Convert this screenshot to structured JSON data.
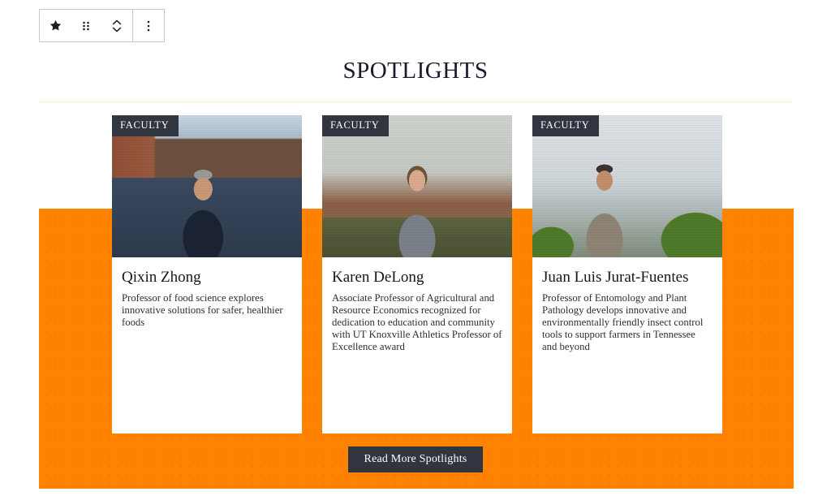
{
  "editor_toolbar": {
    "buttons": [
      {
        "name": "block-type-star-button",
        "icon": "star-icon"
      },
      {
        "name": "drag-handle-button",
        "icon": "drag-dots-icon"
      },
      {
        "name": "move-up-down-button",
        "icon": "chevron-up-down-icon"
      },
      {
        "name": "more-options-button",
        "icon": "vertical-dots-icon"
      }
    ]
  },
  "section": {
    "heading": "SPOTLIGHTS",
    "cta_label": "Read More Spotlights"
  },
  "cards": [
    {
      "badge": "FACULTY",
      "title": "Qixin Zhong",
      "description": "Professor of food science explores innovative solutions for safer, healthier foods",
      "photo_alt": "Qixin Zhong standing in front of the Food Science building"
    },
    {
      "badge": "FACULTY",
      "title": "Karen DeLong",
      "description": "Associate Professor of Agricultural and Resource Economics recognized for dedication to education and community with UT Knoxville Athletics Professor of Excellence award",
      "photo_alt": "Karen DeLong holding a commemorative football outdoors"
    },
    {
      "badge": "FACULTY",
      "title": "Juan Luis Jurat-Fuentes",
      "description": "Professor of Entomology and Plant Pathology develops innovative and environmentally friendly insect control tools to support farmers in Tennessee and beyond",
      "photo_alt": "Juan Luis Jurat-Fuentes standing in a greenhouse among plants"
    }
  ],
  "colors": {
    "brand_orange": "#FF8200",
    "dot_pattern": "#F07A00",
    "badge_dark": "#31353F",
    "button_dark": "#31353F",
    "rule_cream": "#FDF0DB",
    "heading_text": "#1A1A2E"
  }
}
